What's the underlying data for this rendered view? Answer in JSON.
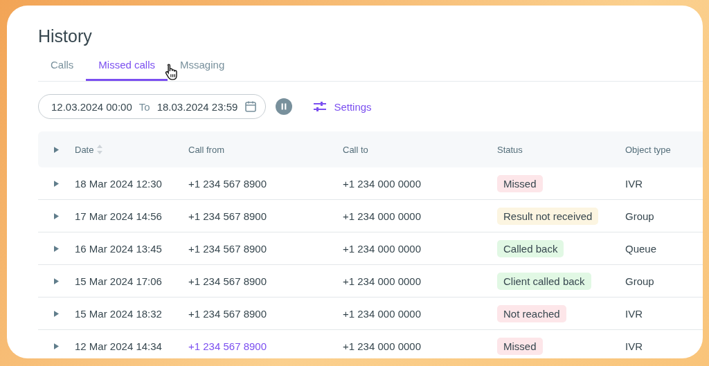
{
  "title": "History",
  "tabs": [
    {
      "label": "Calls",
      "selected": false
    },
    {
      "label": "Missed calls",
      "selected": true
    },
    {
      "label": "Mssaging",
      "selected": false
    }
  ],
  "filters": {
    "date_from": "12.03.2024 00:00",
    "separator": "To",
    "date_to": "18.03.2024 23:59",
    "settings": "Settings"
  },
  "table": {
    "columns": [
      "Date",
      "Call from",
      "Call to",
      "Status",
      "Object type"
    ],
    "rows": [
      {
        "date": "18 Mar 2024 12:30",
        "call_from": "+1 234 567 8900",
        "hovered": false,
        "call_to": "+1 234 000 0000",
        "status": "Missed",
        "color": "#fde6e9",
        "object_type": "IVR"
      },
      {
        "date": "17 Mar 2024 14:56",
        "call_from": "+1 234 567 8900",
        "hovered": false,
        "call_to": "+1 234 000 0000",
        "status": "Result not received",
        "color": "#fcf5e1",
        "object_type": "Group"
      },
      {
        "date": "16 Mar 2024 13:45",
        "call_from": "+1 234 567 8900",
        "hovered": false,
        "call_to": "+1 234 000 0000",
        "status": "Called back",
        "color": "#e1f8e4",
        "object_type": "Queue"
      },
      {
        "date": "15 Mar 2024 17:06",
        "call_from": "+1 234 567 8900",
        "hovered": false,
        "call_to": "+1 234 000 0000",
        "status": "Client called back",
        "color": "#e1f8e4",
        "object_type": "Group"
      },
      {
        "date": "15 Mar 2024 18:32",
        "call_from": "+1 234 567 8900",
        "hovered": false,
        "call_to": "+1 234 000 0000",
        "status": "Not reached",
        "color": "#fde6e9",
        "object_type": "IVR"
      },
      {
        "date": "12 Mar 2024 14:34",
        "call_from": "+1 234 567 8900",
        "hovered": true,
        "call_to": "+1 234 000 0000",
        "status": "Missed",
        "color": "#fde6e9",
        "object_type": "IVR"
      }
    ]
  }
}
